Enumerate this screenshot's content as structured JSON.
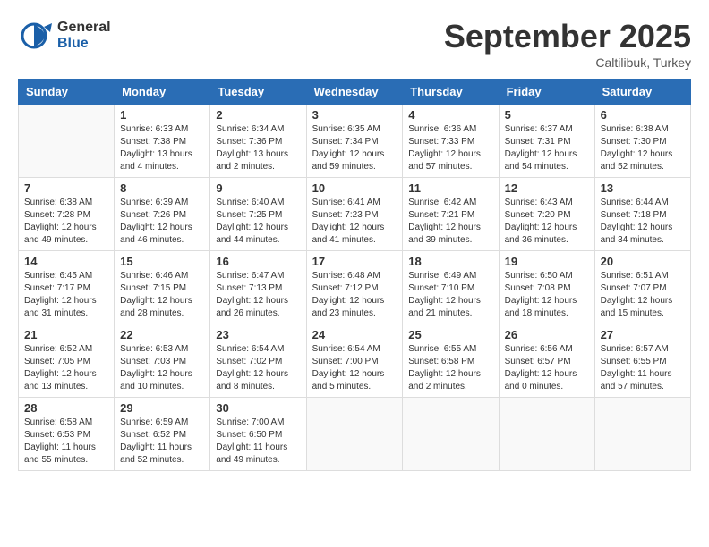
{
  "header": {
    "logo_general": "General",
    "logo_blue": "Blue",
    "month": "September 2025",
    "location": "Caltilibuk, Turkey"
  },
  "weekdays": [
    "Sunday",
    "Monday",
    "Tuesday",
    "Wednesday",
    "Thursday",
    "Friday",
    "Saturday"
  ],
  "weeks": [
    [
      {
        "day": "",
        "info": ""
      },
      {
        "day": "1",
        "info": "Sunrise: 6:33 AM\nSunset: 7:38 PM\nDaylight: 13 hours\nand 4 minutes."
      },
      {
        "day": "2",
        "info": "Sunrise: 6:34 AM\nSunset: 7:36 PM\nDaylight: 13 hours\nand 2 minutes."
      },
      {
        "day": "3",
        "info": "Sunrise: 6:35 AM\nSunset: 7:34 PM\nDaylight: 12 hours\nand 59 minutes."
      },
      {
        "day": "4",
        "info": "Sunrise: 6:36 AM\nSunset: 7:33 PM\nDaylight: 12 hours\nand 57 minutes."
      },
      {
        "day": "5",
        "info": "Sunrise: 6:37 AM\nSunset: 7:31 PM\nDaylight: 12 hours\nand 54 minutes."
      },
      {
        "day": "6",
        "info": "Sunrise: 6:38 AM\nSunset: 7:30 PM\nDaylight: 12 hours\nand 52 minutes."
      }
    ],
    [
      {
        "day": "7",
        "info": "Sunrise: 6:38 AM\nSunset: 7:28 PM\nDaylight: 12 hours\nand 49 minutes."
      },
      {
        "day": "8",
        "info": "Sunrise: 6:39 AM\nSunset: 7:26 PM\nDaylight: 12 hours\nand 46 minutes."
      },
      {
        "day": "9",
        "info": "Sunrise: 6:40 AM\nSunset: 7:25 PM\nDaylight: 12 hours\nand 44 minutes."
      },
      {
        "day": "10",
        "info": "Sunrise: 6:41 AM\nSunset: 7:23 PM\nDaylight: 12 hours\nand 41 minutes."
      },
      {
        "day": "11",
        "info": "Sunrise: 6:42 AM\nSunset: 7:21 PM\nDaylight: 12 hours\nand 39 minutes."
      },
      {
        "day": "12",
        "info": "Sunrise: 6:43 AM\nSunset: 7:20 PM\nDaylight: 12 hours\nand 36 minutes."
      },
      {
        "day": "13",
        "info": "Sunrise: 6:44 AM\nSunset: 7:18 PM\nDaylight: 12 hours\nand 34 minutes."
      }
    ],
    [
      {
        "day": "14",
        "info": "Sunrise: 6:45 AM\nSunset: 7:17 PM\nDaylight: 12 hours\nand 31 minutes."
      },
      {
        "day": "15",
        "info": "Sunrise: 6:46 AM\nSunset: 7:15 PM\nDaylight: 12 hours\nand 28 minutes."
      },
      {
        "day": "16",
        "info": "Sunrise: 6:47 AM\nSunset: 7:13 PM\nDaylight: 12 hours\nand 26 minutes."
      },
      {
        "day": "17",
        "info": "Sunrise: 6:48 AM\nSunset: 7:12 PM\nDaylight: 12 hours\nand 23 minutes."
      },
      {
        "day": "18",
        "info": "Sunrise: 6:49 AM\nSunset: 7:10 PM\nDaylight: 12 hours\nand 21 minutes."
      },
      {
        "day": "19",
        "info": "Sunrise: 6:50 AM\nSunset: 7:08 PM\nDaylight: 12 hours\nand 18 minutes."
      },
      {
        "day": "20",
        "info": "Sunrise: 6:51 AM\nSunset: 7:07 PM\nDaylight: 12 hours\nand 15 minutes."
      }
    ],
    [
      {
        "day": "21",
        "info": "Sunrise: 6:52 AM\nSunset: 7:05 PM\nDaylight: 12 hours\nand 13 minutes."
      },
      {
        "day": "22",
        "info": "Sunrise: 6:53 AM\nSunset: 7:03 PM\nDaylight: 12 hours\nand 10 minutes."
      },
      {
        "day": "23",
        "info": "Sunrise: 6:54 AM\nSunset: 7:02 PM\nDaylight: 12 hours\nand 8 minutes."
      },
      {
        "day": "24",
        "info": "Sunrise: 6:54 AM\nSunset: 7:00 PM\nDaylight: 12 hours\nand 5 minutes."
      },
      {
        "day": "25",
        "info": "Sunrise: 6:55 AM\nSunset: 6:58 PM\nDaylight: 12 hours\nand 2 minutes."
      },
      {
        "day": "26",
        "info": "Sunrise: 6:56 AM\nSunset: 6:57 PM\nDaylight: 12 hours\nand 0 minutes."
      },
      {
        "day": "27",
        "info": "Sunrise: 6:57 AM\nSunset: 6:55 PM\nDaylight: 11 hours\nand 57 minutes."
      }
    ],
    [
      {
        "day": "28",
        "info": "Sunrise: 6:58 AM\nSunset: 6:53 PM\nDaylight: 11 hours\nand 55 minutes."
      },
      {
        "day": "29",
        "info": "Sunrise: 6:59 AM\nSunset: 6:52 PM\nDaylight: 11 hours\nand 52 minutes."
      },
      {
        "day": "30",
        "info": "Sunrise: 7:00 AM\nSunset: 6:50 PM\nDaylight: 11 hours\nand 49 minutes."
      },
      {
        "day": "",
        "info": ""
      },
      {
        "day": "",
        "info": ""
      },
      {
        "day": "",
        "info": ""
      },
      {
        "day": "",
        "info": ""
      }
    ]
  ]
}
